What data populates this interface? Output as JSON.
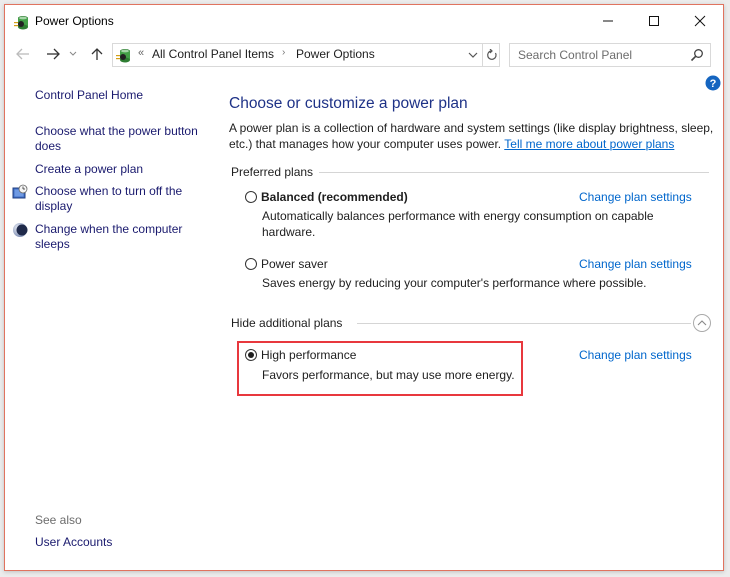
{
  "window": {
    "title": "Power Options",
    "controls": {
      "minimize": "minimize",
      "maximize": "maximize",
      "close": "close"
    }
  },
  "navigation": {
    "back": "back-arrow",
    "forward": "forward-arrow",
    "recent": "recent-locations",
    "up": "up-arrow",
    "address": {
      "overflow": "«",
      "crumbs": [
        "All Control Panel Items",
        "Power Options"
      ],
      "separator": "›"
    },
    "search_placeholder": "Search Control Panel"
  },
  "sidebar": {
    "home": "Control Panel Home",
    "links": [
      {
        "label": "Choose what the power button does",
        "icon": null
      },
      {
        "label": "Create a power plan",
        "icon": null
      },
      {
        "label": "Choose when to turn off the display",
        "icon": "display-timer-icon"
      },
      {
        "label": "Change when the computer sleeps",
        "icon": "sleep-moon-icon"
      }
    ],
    "see_also_label": "See also",
    "see_also_links": [
      "User Accounts"
    ]
  },
  "main": {
    "title": "Choose or customize a power plan",
    "description": "A power plan is a collection of hardware and system settings (like display brightness, sleep, etc.) that manages how your computer uses power.",
    "learn_more_link": "Tell me more about power plans",
    "preferred_header": "Preferred plans",
    "additional_header": "Hide additional plans",
    "change_settings_label": "Change plan settings",
    "plans": [
      {
        "name": "Balanced (recommended)",
        "description": "Automatically balances performance with energy consumption on capable hardware.",
        "selected": false,
        "bold": true
      },
      {
        "name": "Power saver",
        "description": "Saves energy by reducing your computer's performance where possible.",
        "selected": false,
        "bold": false
      },
      {
        "name": "High performance",
        "description": "Favors performance, but may use more energy.",
        "selected": true,
        "bold": false
      }
    ]
  },
  "colors": {
    "window_border": "#e0735f",
    "link": "#0066cc",
    "sidebar_link": "#1a1a6e",
    "title": "#1e3287",
    "highlight": "#e8383d",
    "help_icon": "#1565c0"
  }
}
